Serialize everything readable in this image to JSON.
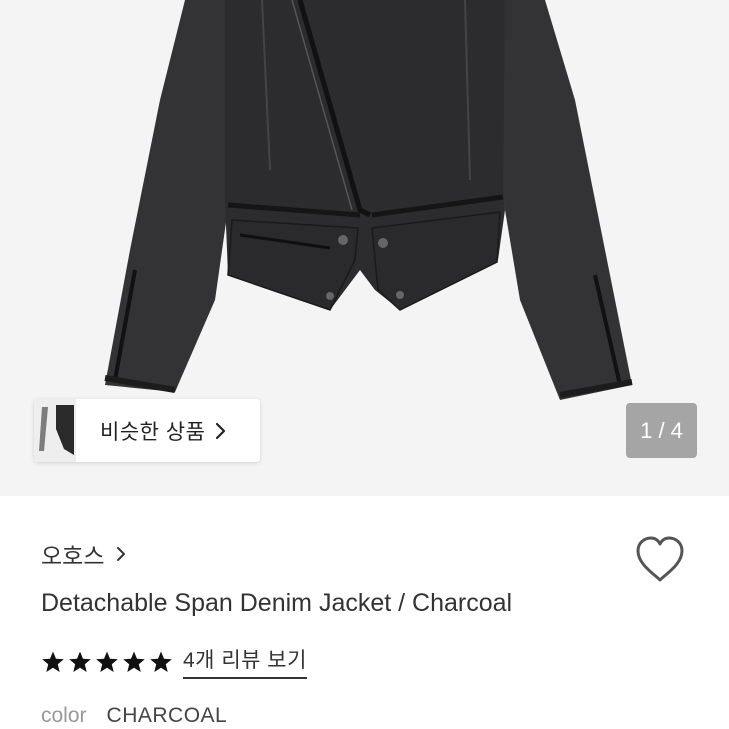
{
  "gallery": {
    "similar_button": {
      "label": "비슷한 상품"
    },
    "page_counter": "1 / 4"
  },
  "product": {
    "brand": "오호스",
    "title": "Detachable Span Denim Jacket / Charcoal",
    "rating": {
      "stars": 5,
      "max": 5,
      "review_link": "4개 리뷰 보기"
    },
    "color": {
      "label": "color",
      "value": "CHARCOAL"
    }
  },
  "colors": {
    "jacket": "#2e2e30",
    "star": "#111111",
    "background": "#f4f4f4"
  },
  "icons": [
    "chevron-right-icon",
    "heart-icon",
    "star-icon"
  ]
}
